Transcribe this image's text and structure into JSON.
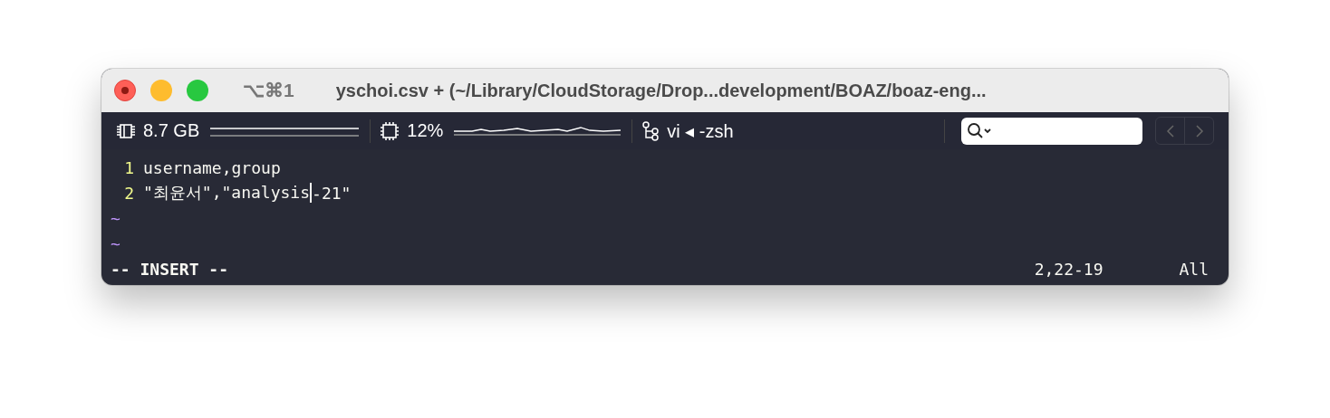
{
  "window": {
    "shortcut": "⌥⌘1",
    "title": "yschoi.csv + (~/Library/CloudStorage/Drop...development/BOAZ/boaz-eng..."
  },
  "status_bar": {
    "memory": "8.7 GB",
    "cpu": "12%",
    "job": "vi ◂ -zsh"
  },
  "editor": {
    "lines": [
      {
        "number": "1",
        "text": "username,group"
      },
      {
        "number": "2",
        "text": "\"최윤서\",\"analysis",
        "text_after_cursor": "-21\""
      }
    ],
    "empty_lines": [
      "~",
      "~"
    ],
    "mode": "-- INSERT --",
    "position": "2,22-19",
    "scroll": "All"
  }
}
